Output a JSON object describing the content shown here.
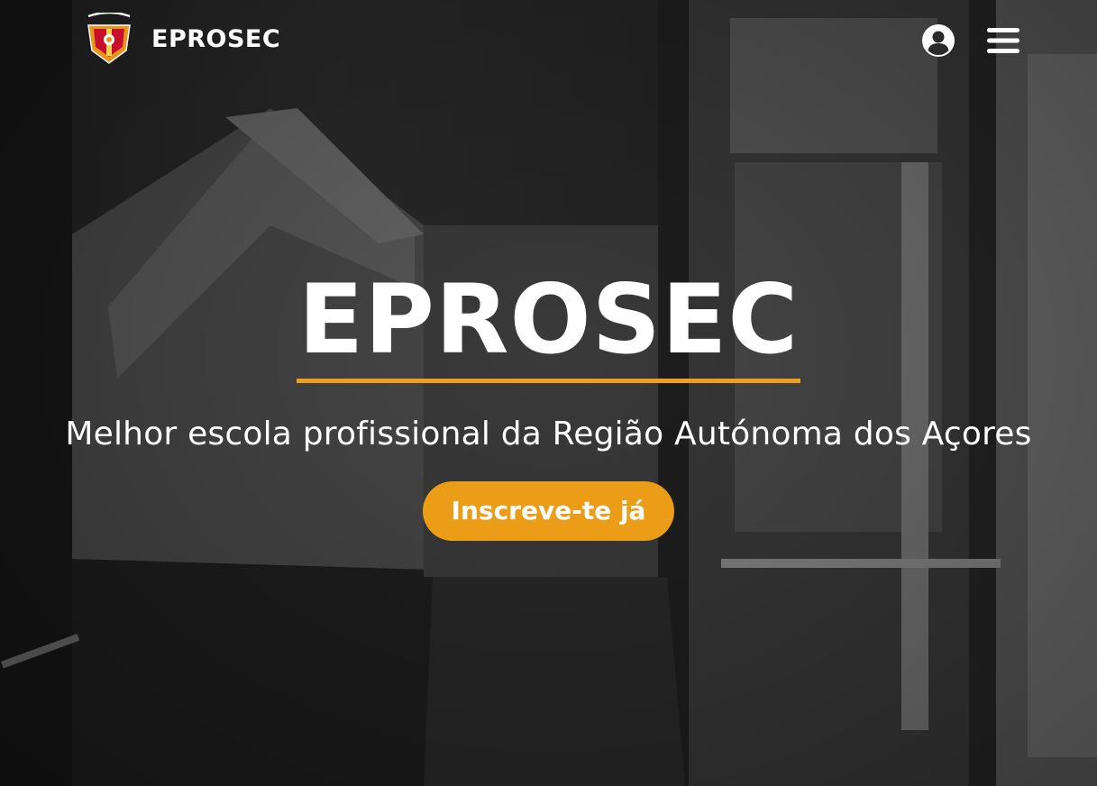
{
  "header": {
    "brand_name": "EPROSEC",
    "logo_text": "EPROSEC",
    "icons": {
      "user": "user-circle-icon",
      "menu": "hamburger-menu-icon"
    }
  },
  "hero": {
    "title": "EPROSEC",
    "subtitle": "Melhor escola profissional da Região Autónoma dos Açores",
    "cta_label": "Inscreve-te já"
  },
  "colors": {
    "accent": "#eb9d18",
    "text": "#ffffff",
    "background": "#2a2a2a"
  }
}
